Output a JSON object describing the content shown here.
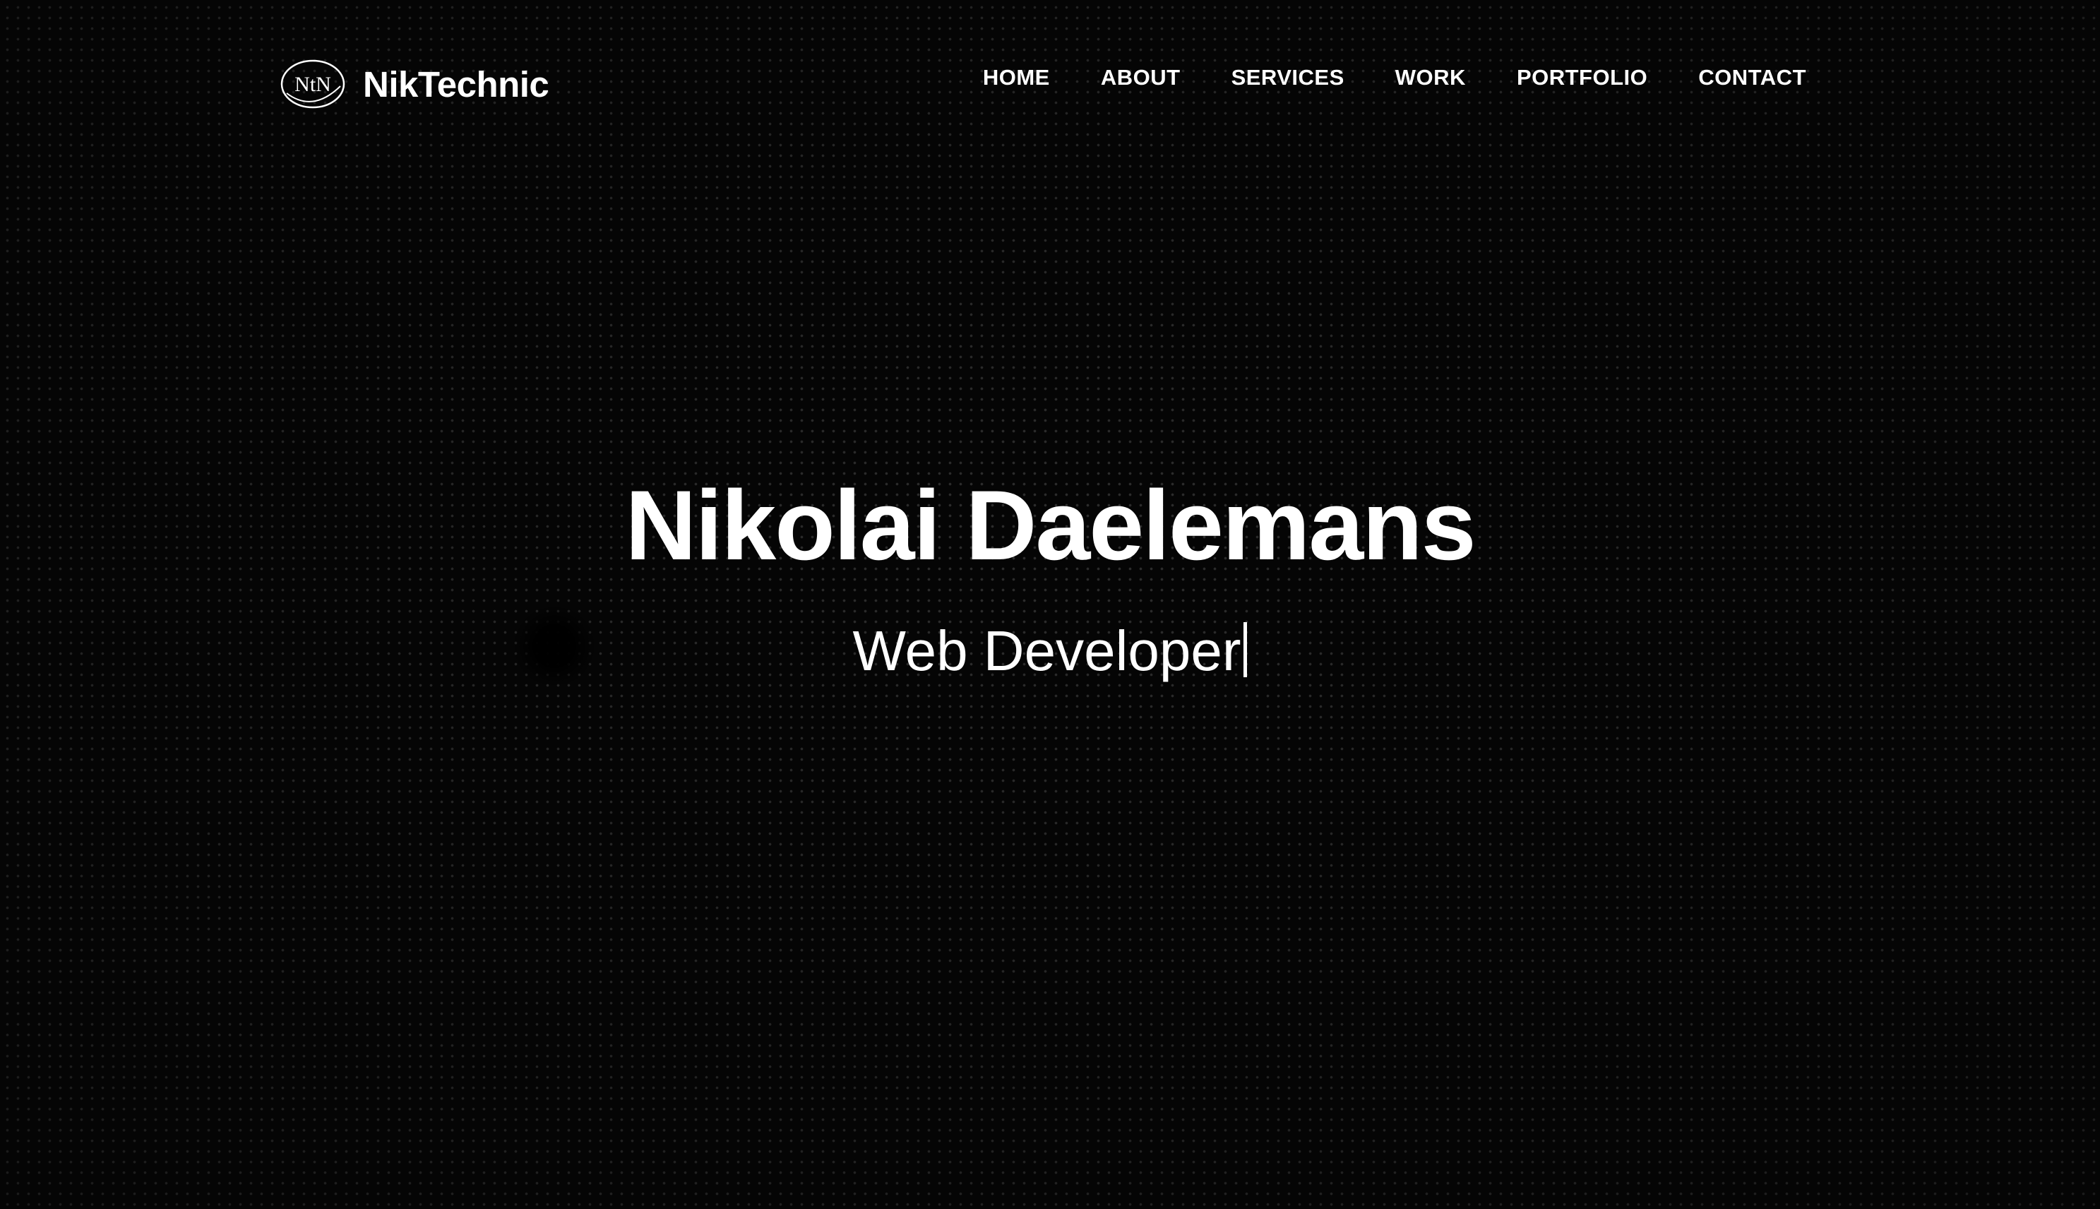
{
  "header": {
    "logo": {
      "monogram": "NtN",
      "icon": "niktechnic-logo-icon"
    },
    "brand_name": "NikTechnic",
    "nav": [
      {
        "label": "HOME"
      },
      {
        "label": "ABOUT"
      },
      {
        "label": "SERVICES"
      },
      {
        "label": "WORK"
      },
      {
        "label": "PORTFOLIO"
      },
      {
        "label": "CONTACT"
      }
    ]
  },
  "hero": {
    "name": "Nikolai Daelemans",
    "role": "Web Developer"
  },
  "colors": {
    "background": "#050505",
    "text": "#ffffff",
    "dot_pattern": "#ffffff"
  }
}
